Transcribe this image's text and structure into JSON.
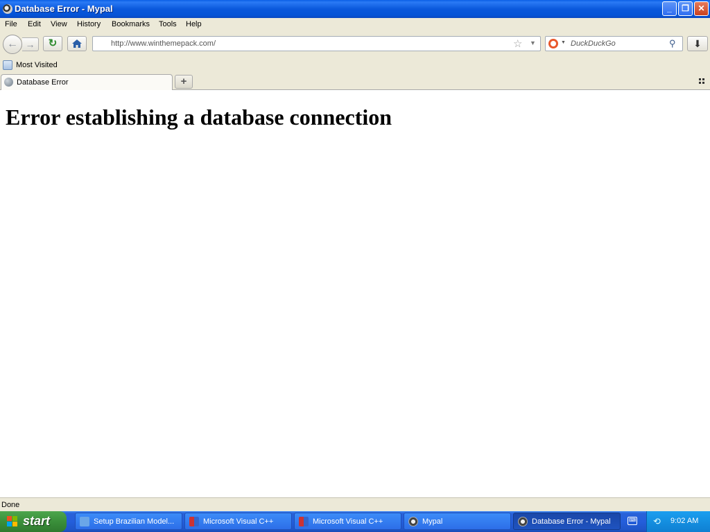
{
  "window": {
    "title": "Database Error - Mypal",
    "app_icon": "mypal-raccoon-icon",
    "controls": {
      "minimize": "_",
      "maximize": "❐",
      "close": "✕"
    }
  },
  "menubar": {
    "items": [
      {
        "label": "File"
      },
      {
        "label": "Edit"
      },
      {
        "label": "View"
      },
      {
        "label": "History"
      },
      {
        "label": "Bookmarks"
      },
      {
        "label": "Tools"
      },
      {
        "label": "Help"
      }
    ]
  },
  "navbar": {
    "back_icon": "arrow-left-icon",
    "forward_icon": "arrow-right-icon",
    "reload_icon": "reload-icon",
    "home_icon": "home-icon",
    "url": "http://www.winthemepack.com/",
    "bookmark_star_icon": "star-icon",
    "search_placeholder": "DuckDuckGo",
    "search_engine_icon": "duckduckgo-icon",
    "download_icon": "download-icon"
  },
  "bookmarks": {
    "most_visited_label": "Most Visited"
  },
  "tabs": [
    {
      "label": "Database Error",
      "active": true
    }
  ],
  "content": {
    "heading": "Error establishing a database connection"
  },
  "statusbar": {
    "text": "Done"
  },
  "taskbar": {
    "start_label": "start",
    "tasks": [
      {
        "label": "Setup Brazilian Model...",
        "active": false
      },
      {
        "label": "Microsoft Visual C++",
        "active": false
      },
      {
        "label": "Microsoft Visual C++",
        "active": false
      },
      {
        "label": "Mypal",
        "active": false
      },
      {
        "label": "Database Error - Mypal",
        "active": true
      }
    ],
    "clock": "9:02 AM"
  },
  "colors": {
    "titlebar_blue": "#0a58dc",
    "chrome_bg": "#ece9d8",
    "taskbar_blue": "#245edb",
    "start_green": "#3a8f3a",
    "tray_blue": "#148fe0"
  }
}
